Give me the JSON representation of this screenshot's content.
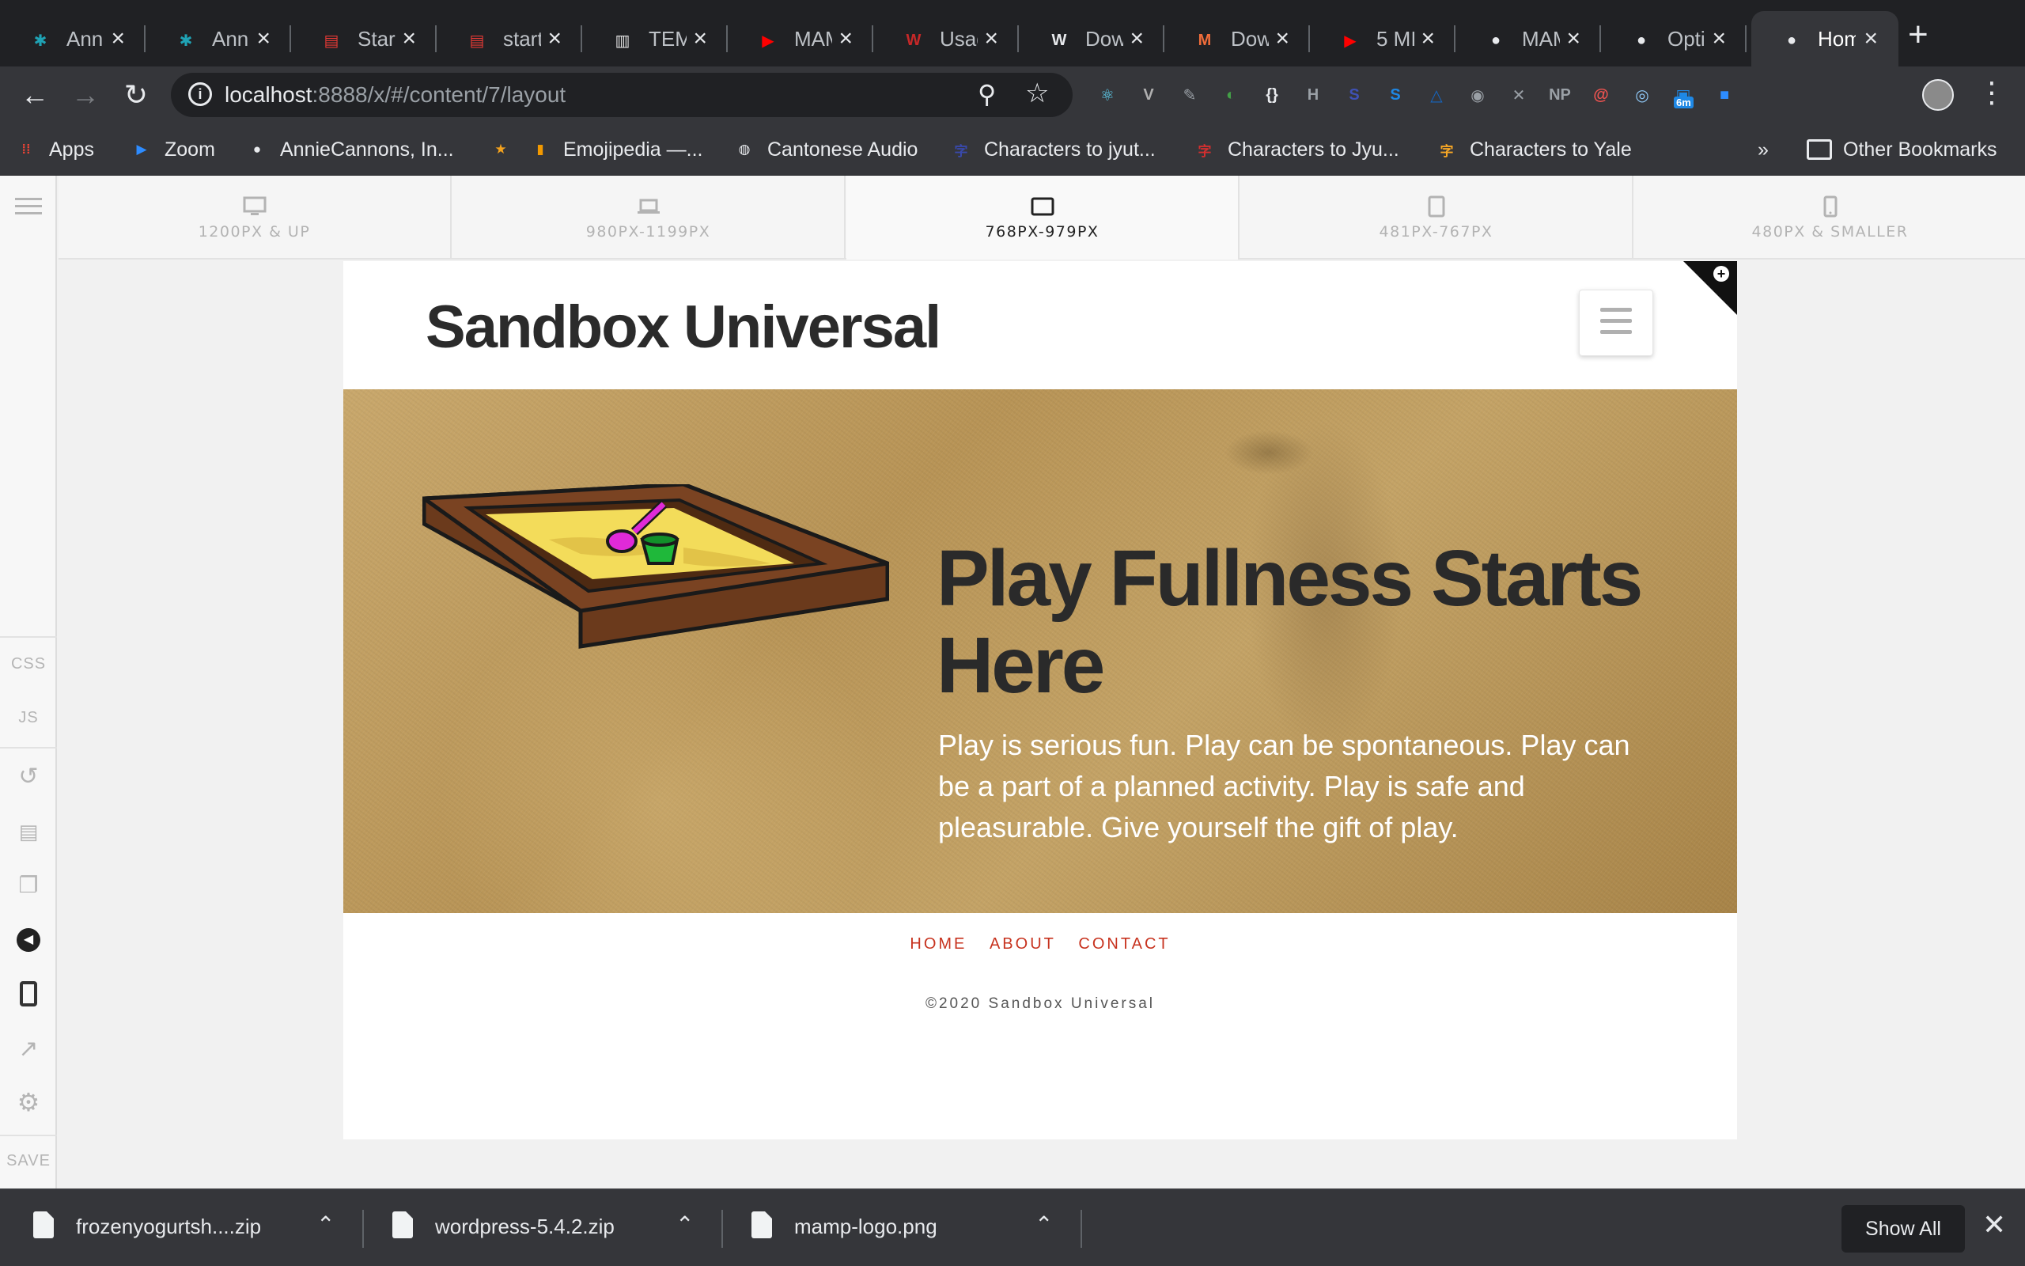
{
  "browser": {
    "tabs": [
      {
        "title": "Annie",
        "icon": "asterisk-icon",
        "color": "#1fa3b5"
      },
      {
        "title": "Annie",
        "icon": "asterisk-icon",
        "color": "#1fa3b5"
      },
      {
        "title": "Start",
        "icon": "clapper-icon",
        "color": "#e53935"
      },
      {
        "title": "start",
        "icon": "clapper-icon",
        "color": "#e53935"
      },
      {
        "title": "TEMP",
        "icon": "document-icon",
        "color": "#e0e0e0"
      },
      {
        "title": "MAM",
        "icon": "youtube-icon",
        "color": "#ff0000"
      },
      {
        "title": "Usag",
        "icon": "w3-icon",
        "color": "#c62828"
      },
      {
        "title": "Down",
        "icon": "wordpress-icon",
        "color": "#e8eaed"
      },
      {
        "title": "Down",
        "icon": "m-logo-icon",
        "color": "#ef6c3a"
      },
      {
        "title": "5 MI",
        "icon": "youtube-icon",
        "color": "#ff0000"
      },
      {
        "title": "MAM",
        "icon": "elephant-icon",
        "color": "#e8eaed"
      },
      {
        "title": "Optio",
        "icon": "elephant-icon",
        "color": "#e8eaed"
      },
      {
        "title": "Hom",
        "icon": "elephant-icon",
        "color": "#e8eaed",
        "active": true
      }
    ],
    "url_host": "localhost",
    "url_rest": ":8888/x/#/content/7/layout",
    "bookmarks": [
      {
        "label": "Apps",
        "icon": "apps-grid-icon",
        "color": "#ea4335"
      },
      {
        "label": "Zoom",
        "icon": "zoom-icon",
        "color": "#2d8cff"
      },
      {
        "label": "AnnieCannons, In...",
        "icon": "github-icon",
        "color": "#e8eaed"
      },
      {
        "label": "",
        "icon": "badge-icon",
        "color": "#f4a21d"
      },
      {
        "label": "Emojipedia —...",
        "icon": "bookmark-icon",
        "color": "#f29900"
      },
      {
        "label": "Cantonese Audio",
        "icon": "globe-icon",
        "color": "#e8eaed"
      },
      {
        "label": "Characters to jyut...",
        "icon": "character-icon",
        "color": "#3949ab"
      },
      {
        "label": "Characters to Jyu...",
        "icon": "character-icon",
        "color": "#d32f2f"
      },
      {
        "label": "Characters to Yale",
        "icon": "character-icon",
        "color": "#f9a825"
      }
    ],
    "bookmarks_more": "»",
    "other_bookmarks": "Other Bookmarks",
    "extensions": [
      {
        "icon": "react-icon",
        "color": "#61dafb"
      },
      {
        "icon": "vue-icon",
        "color": "#b0b0b0"
      },
      {
        "icon": "eyedropper-icon",
        "color": "#9aa0a6"
      },
      {
        "icon": "color-wheel-icon",
        "color": "#43a047"
      },
      {
        "icon": "json-icon",
        "color": "#e8eaed"
      },
      {
        "icon": "h-icon",
        "color": "#9aa0a6"
      },
      {
        "icon": "s-badge-icon",
        "color": "#3f51b5"
      },
      {
        "icon": "s-square-icon",
        "color": "#1e88e5"
      },
      {
        "icon": "triangle-icon",
        "color": "#1565c0"
      },
      {
        "icon": "camera-icon",
        "color": "#9aa0a6"
      },
      {
        "icon": "puzzle-icon",
        "color": "#9aa0a6"
      },
      {
        "icon": "np-icon",
        "color": "#9aa0a6"
      },
      {
        "icon": "spiral-icon",
        "color": "#ef5350"
      },
      {
        "icon": "eye-icon",
        "color": "#90caf9"
      },
      {
        "icon": "timer-icon",
        "color": "#1e88e5",
        "badge": "6m"
      },
      {
        "icon": "zoom-ext-icon",
        "color": "#2d8cff"
      }
    ]
  },
  "editor": {
    "sidebar": {
      "css": "CSS",
      "js": "JS",
      "save": "SAVE"
    },
    "devices": [
      {
        "label": "1200PX & UP",
        "icon": "desktop-icon"
      },
      {
        "label": "980PX-1199PX",
        "icon": "laptop-icon"
      },
      {
        "label": "768PX-979PX",
        "icon": "tablet-landscape-icon",
        "active": true
      },
      {
        "label": "481PX-767PX",
        "icon": "tablet-portrait-icon"
      },
      {
        "label": "480PX & SMALLER",
        "icon": "phone-icon"
      }
    ]
  },
  "site": {
    "title": "Sandbox Universal",
    "hero_heading": "Play Fullness Starts Here",
    "hero_text": "Play is serious fun. Play can be spontaneous. Play can be a part of a planned activity. Play is safe and pleasurable. Give yourself the gift of play.",
    "nav": [
      "HOME",
      "ABOUT",
      "CONTACT"
    ],
    "copyright": "©2020 Sandbox Universal",
    "accent": "#c7331f"
  },
  "downloads": {
    "items": [
      {
        "name": "frozenyogurtsh....zip",
        "icon": "zip-file-icon"
      },
      {
        "name": "wordpress-5.4.2.zip",
        "icon": "zip-file-icon"
      },
      {
        "name": "mamp-logo.png",
        "icon": "image-file-icon"
      }
    ],
    "show_all": "Show All"
  }
}
